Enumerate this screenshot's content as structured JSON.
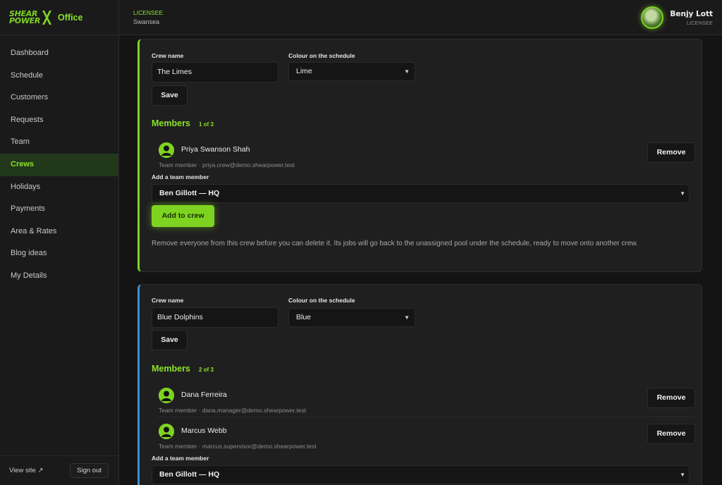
{
  "brand": {
    "logo_line1": "SHEAR",
    "logo_line2": "POWER",
    "logo_x": "X",
    "app_name": "Office",
    "accent": "#7ed321"
  },
  "sidebar": {
    "items": [
      {
        "label": "Dashboard",
        "active": false
      },
      {
        "label": "Schedule",
        "active": false
      },
      {
        "label": "Customers",
        "active": false
      },
      {
        "label": "Requests",
        "active": false
      },
      {
        "label": "Team",
        "active": false
      },
      {
        "label": "Crews",
        "active": true
      },
      {
        "label": "Holidays",
        "active": false
      },
      {
        "label": "Payments",
        "active": false
      },
      {
        "label": "Area & Rates",
        "active": false
      },
      {
        "label": "Blog ideas",
        "active": false
      },
      {
        "label": "My Details",
        "active": false
      }
    ],
    "view_site": "View site ↗",
    "sign_out": "Sign out"
  },
  "header": {
    "licensee_label": "LICENSEE",
    "location": "Swansea",
    "user_name": "Benjy Lott",
    "user_role": "LICENSEE"
  },
  "crews": [
    {
      "crew_name_label": "Crew name",
      "crew_name": "The Limes",
      "colour_label": "Colour on the schedule",
      "colour": "Lime",
      "border_color": "#7ed321",
      "save_label": "Save",
      "members_title": "Members",
      "members_count": "1 of 3",
      "members": [
        {
          "name": "Priya Swanson Shah",
          "sub": "Team member · priya.crew@demo.shearpower.test",
          "remove_label": "Remove"
        }
      ],
      "add_label": "Add a team member",
      "add_select": "Ben Gillott — HQ",
      "add_button": "Add to crew",
      "note": "Remove everyone from this crew before you can delete it. Its jobs will go back to the unassigned pool under the schedule, ready to move onto another crew."
    },
    {
      "crew_name_label": "Crew name",
      "crew_name": "Blue Dolphins",
      "colour_label": "Colour on the schedule",
      "colour": "Blue",
      "border_color": "#3d8fd6",
      "save_label": "Save",
      "members_title": "Members",
      "members_count": "2 of 3",
      "members": [
        {
          "name": "Dana Ferreira",
          "sub": "Team member · dana.manager@demo.shearpower.test",
          "remove_label": "Remove"
        },
        {
          "name": "Marcus Webb",
          "sub": "Team member · marcus.supervisor@demo.shearpower.test",
          "remove_label": "Remove"
        }
      ],
      "add_label": "Add a team member",
      "add_select": "Ben Gillott — HQ"
    }
  ]
}
